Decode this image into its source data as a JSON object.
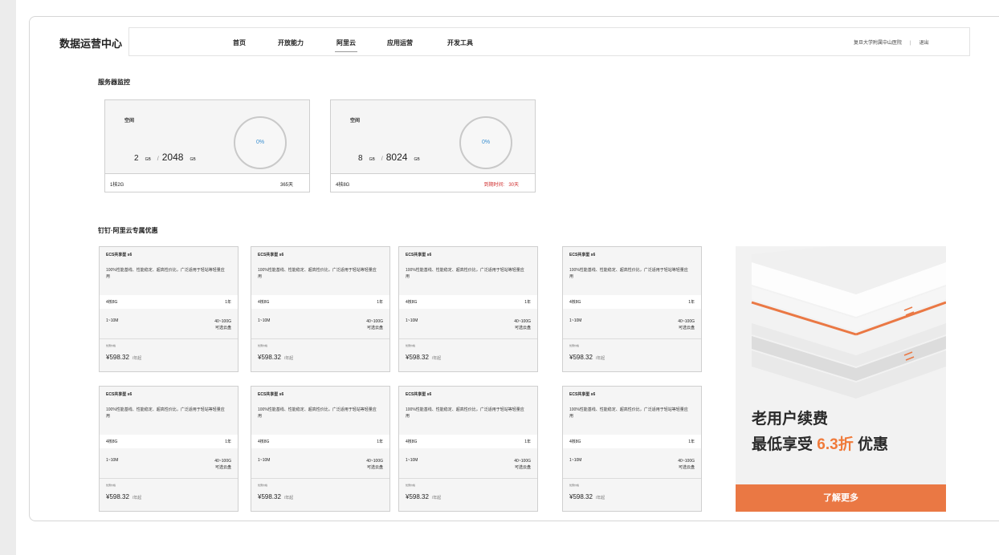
{
  "brand": "数据运营中心",
  "nav": {
    "items": [
      {
        "label": "首页",
        "active": false
      },
      {
        "label": "开放能力",
        "active": false
      },
      {
        "label": "阿里云",
        "active": true
      },
      {
        "label": "应用运营",
        "active": false
      },
      {
        "label": "开发工具",
        "active": false
      }
    ],
    "user": "复旦大学附属中山医院",
    "sep": "|",
    "logout": "退出"
  },
  "service_monitor": {
    "title": "服务器监控",
    "cards": [
      {
        "label": "空间",
        "used": "2",
        "used_unit": "GB",
        "slash": "/",
        "total": "2048",
        "total_unit": "GB",
        "percent": "0%",
        "percent_value": 0,
        "spec": "1核2G",
        "period_label": "",
        "period": "365天"
      },
      {
        "label": "空间",
        "used": "8",
        "used_unit": "GB",
        "slash": "/",
        "total": "8024",
        "total_unit": "GB",
        "percent": "0%",
        "percent_value": 0,
        "spec": "4核8G",
        "period_label": "到期时间:",
        "period": "30天"
      }
    ]
  },
  "promo": {
    "title": "钉钉·阿里云专属优惠",
    "products": [
      {
        "name": "ECS共享型 s6",
        "desc": "100%性能基线、性能稳定、超高性价比，广泛适用于轻站等轻量应用",
        "spec": "4核8G",
        "term": "1年",
        "bandwidth": "1~10M",
        "disk": "40~100G",
        "disk_note": "可选云盘",
        "price_label": "优惠价格",
        "price": "¥598.32",
        "price_unit": "/年起"
      },
      {
        "name": "ECS共享型 s6",
        "desc": "100%性能基线、性能稳定、超高性价比，广泛适用于轻站等轻量应用",
        "spec": "4核8G",
        "term": "1年",
        "bandwidth": "1~10M",
        "disk": "40~100G",
        "disk_note": "可选云盘",
        "price_label": "优惠价格",
        "price": "¥598.32",
        "price_unit": "/年起"
      },
      {
        "name": "ECS共享型 s6",
        "desc": "100%性能基线、性能稳定、超高性价比，广泛适用于轻站等轻量应用",
        "spec": "4核8G",
        "term": "1年",
        "bandwidth": "1~10M",
        "disk": "40~100G",
        "disk_note": "可选云盘",
        "price_label": "优惠价格",
        "price": "¥598.32",
        "price_unit": "/年起"
      },
      {
        "name": "ECS共享型 s6",
        "desc": "100%性能基线、性能稳定、超高性价比，广泛适用于轻站等轻量应用",
        "spec": "4核8G",
        "term": "1年",
        "bandwidth": "1~10M",
        "disk": "40~100G",
        "disk_note": "可选云盘",
        "price_label": "优惠价格",
        "price": "¥598.32",
        "price_unit": "/年起"
      },
      {
        "name": "ECS共享型 s6",
        "desc": "100%性能基线、性能稳定、超高性价比，广泛适用于轻站等轻量应用",
        "spec": "4核8G",
        "term": "1年",
        "bandwidth": "1~10M",
        "disk": "40~100G",
        "disk_note": "可选云盘",
        "price_label": "优惠价格",
        "price": "¥598.32",
        "price_unit": "/年起"
      },
      {
        "name": "ECS共享型 s6",
        "desc": "100%性能基线、性能稳定、超高性价比，广泛适用于轻站等轻量应用",
        "spec": "4核8G",
        "term": "1年",
        "bandwidth": "1~10M",
        "disk": "40~100G",
        "disk_note": "可选云盘",
        "price_label": "优惠价格",
        "price": "¥598.32",
        "price_unit": "/年起"
      },
      {
        "name": "ECS共享型 s6",
        "desc": "100%性能基线、性能稳定、超高性价比，广泛适用于轻站等轻量应用",
        "spec": "4核8G",
        "term": "1年",
        "bandwidth": "1~10M",
        "disk": "40~100G",
        "disk_note": "可选云盘",
        "price_label": "优惠价格",
        "price": "¥598.32",
        "price_unit": "/年起"
      },
      {
        "name": "ECS共享型 s6",
        "desc": "100%性能基线、性能稳定、超高性价比，广泛适用于轻站等轻量应用",
        "spec": "4核8G",
        "term": "1年",
        "bandwidth": "1~10M",
        "disk": "40~100G",
        "disk_note": "可选云盘",
        "price_label": "优惠价格",
        "price": "¥598.32",
        "price_unit": "/年起"
      }
    ]
  },
  "banner": {
    "line1": "老用户续费",
    "line2_prefix": "最低享受",
    "line2_highlight": "6.3折",
    "line2_suffix": "优惠",
    "button": "了解更多",
    "accent": "#ea7844"
  }
}
